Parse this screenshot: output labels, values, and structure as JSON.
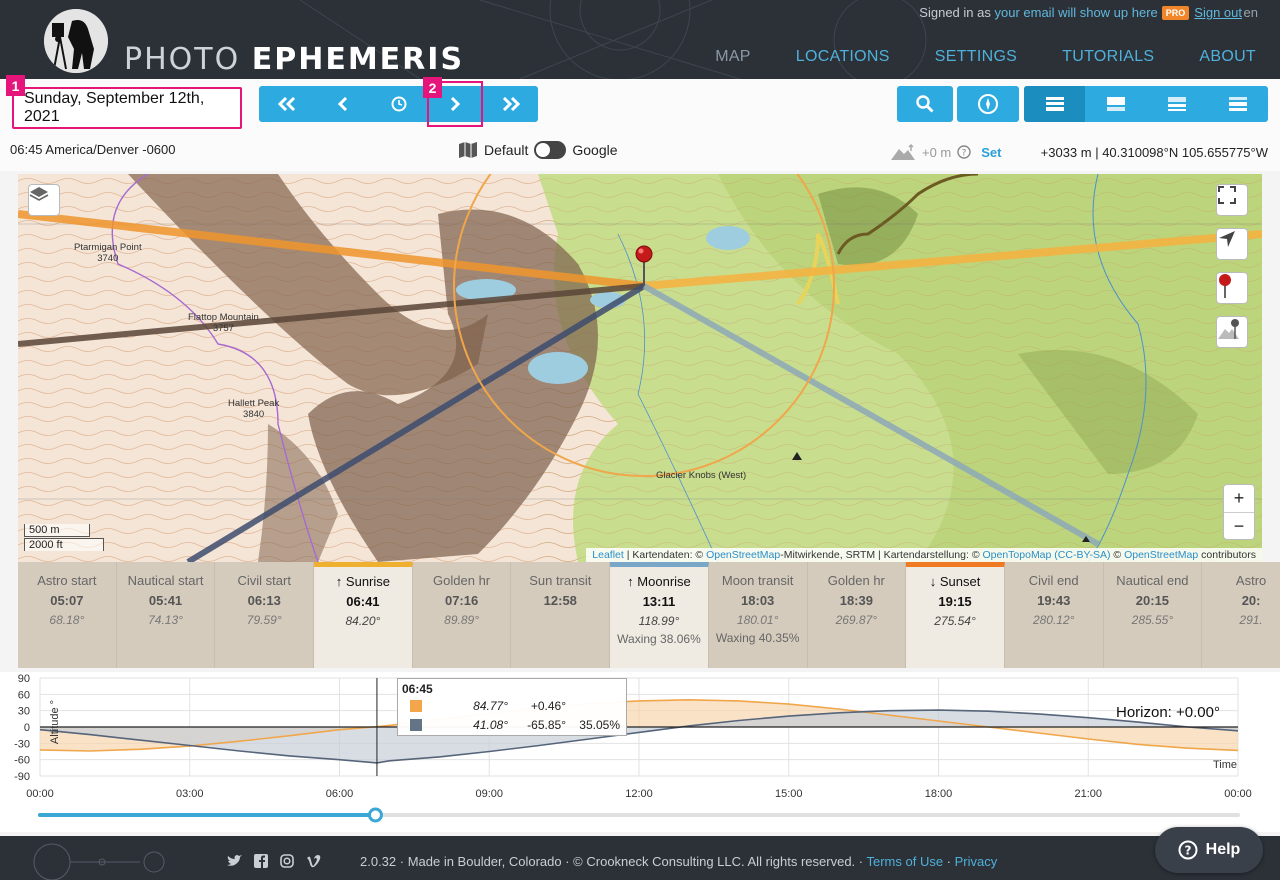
{
  "header": {
    "logo_light": "PHOTO",
    "logo_bold": "EPHEMERIS",
    "signin_prefix": "Signed in as",
    "signin_email": "your email will show up here",
    "pro_badge": "PRO",
    "sign_out": "Sign out",
    "lang": "en",
    "nav": [
      "MAP",
      "LOCATIONS",
      "SETTINGS",
      "TUTORIALS",
      "ABOUT"
    ]
  },
  "toolbar": {
    "date": "Sunday, September 12th, 2021",
    "markers": [
      "1",
      "2"
    ],
    "timezone": "06:45 America/Denver -0600",
    "map_toggle_left": "Default",
    "map_toggle_right": "Google",
    "elevation": "+0 m",
    "elevation_set": "Set",
    "coords": "+3033 m | 40.310098°N 105.655775°W"
  },
  "map": {
    "labels": [
      {
        "name": "Ptarmigan Point",
        "elev": "3740"
      },
      {
        "name": "Flattop Mountain",
        "elev": "3757"
      },
      {
        "name": "Hallett Peak",
        "elev": "3840"
      },
      {
        "name": "Glacier Knobs (West)",
        "elev": ""
      }
    ],
    "scale_m": "500 m",
    "scale_ft": "2000 ft",
    "zoom_in": "+",
    "zoom_out": "−",
    "attribution": {
      "leaflet": "Leaflet",
      "a": " | Kartendaten: © ",
      "osm1": "OpenStreetMap",
      "b": "-Mitwirkende, SRTM | Kartendarstellung: © ",
      "otm": "OpenTopoMap",
      "lic": "(CC-BY-SA)",
      "c": " © ",
      "osm2": "OpenStreetMap",
      "d": " contributors"
    }
  },
  "timeline": [
    {
      "name": "Astro start",
      "time": "05:07",
      "az": "68.18°",
      "extra": ""
    },
    {
      "name": "Nautical start",
      "time": "05:41",
      "az": "74.13°",
      "extra": ""
    },
    {
      "name": "Civil start",
      "time": "06:13",
      "az": "79.59°",
      "extra": ""
    },
    {
      "name": "Sunrise",
      "time": "06:41",
      "az": "84.20°",
      "extra": "",
      "hl": true,
      "color": "#efb02f",
      "arrow": "up"
    },
    {
      "name": "Golden hr",
      "time": "07:16",
      "az": "89.89°",
      "extra": ""
    },
    {
      "name": "Sun transit",
      "time": "12:58",
      "az": "",
      "extra": ""
    },
    {
      "name": "Moonrise",
      "time": "13:11",
      "az": "118.99°",
      "extra": "Waxing 38.06%",
      "hl": true,
      "color": "#7aa7c7",
      "arrow": "up"
    },
    {
      "name": "Moon transit",
      "time": "18:03",
      "az": "180.01°",
      "extra": "Waxing 40.35%"
    },
    {
      "name": "Golden hr",
      "time": "18:39",
      "az": "269.87°",
      "extra": ""
    },
    {
      "name": "Sunset",
      "time": "19:15",
      "az": "275.54°",
      "extra": "",
      "hl": true,
      "color": "#ef7a22",
      "arrow": "down"
    },
    {
      "name": "Civil end",
      "time": "19:43",
      "az": "280.12°",
      "extra": ""
    },
    {
      "name": "Nautical end",
      "time": "20:15",
      "az": "285.55°",
      "extra": ""
    },
    {
      "name": "Astro",
      "time": "20:",
      "az": "291.",
      "extra": ""
    }
  ],
  "chart_data": {
    "type": "area",
    "ylabel": "Altitude °",
    "xlabel": "Time",
    "ylim": [
      -90,
      90
    ],
    "yticks": [
      90,
      60,
      30,
      0,
      -30,
      -60,
      -90
    ],
    "xticks": [
      "00:00",
      "03:00",
      "06:00",
      "09:00",
      "12:00",
      "15:00",
      "18:00",
      "21:00",
      "00:00"
    ],
    "horizon_label": "Horizon: +0.00°",
    "current_time": 6.75,
    "series": [
      {
        "color": "#f0a64a",
        "fill": "#f7d6ae",
        "x": [
          0,
          1,
          2,
          3,
          4,
          5,
          6,
          6.75,
          7,
          8,
          9,
          10,
          11,
          12,
          13,
          14,
          15,
          16,
          17,
          18,
          19,
          20,
          21,
          22,
          23,
          24
        ],
        "y": [
          -42,
          -44,
          -41,
          -35,
          -26,
          -16,
          -5,
          0.5,
          3,
          14,
          25,
          35,
          43,
          48,
          50,
          48,
          42,
          33,
          22,
          11,
          0,
          -11,
          -22,
          -32,
          -39,
          -43
        ]
      },
      {
        "color": "#56647a",
        "fill": "#c7cfd9",
        "x": [
          0,
          1,
          2,
          3,
          4,
          5,
          6,
          6.75,
          7,
          8,
          9,
          10,
          11,
          12,
          13,
          14,
          15,
          16,
          17,
          18,
          19,
          20,
          21,
          22,
          23,
          24
        ],
        "y": [
          -5,
          -14,
          -24,
          -34,
          -44,
          -53,
          -60,
          -65.9,
          -62,
          -55,
          -45,
          -34,
          -22,
          -10,
          2,
          12,
          20,
          26,
          30,
          31,
          29,
          24,
          17,
          9,
          0,
          -7
        ]
      }
    ],
    "tooltip": {
      "time": "06:45",
      "rows": [
        {
          "color": "#f4a64a",
          "azimuth": "84.77°",
          "altitude": "+0.46°",
          "extra": ""
        },
        {
          "color": "#657387",
          "azimuth": "41.08°",
          "altitude": "-65.85°",
          "extra": "35.05%"
        }
      ]
    },
    "slider_fraction": 0.28
  },
  "footer": {
    "text": "2.0.32 · Made in Boulder, Colorado · © Crookneck Consulting LLC. All rights reserved. · ",
    "terms": "Terms of Use",
    "sep": " · ",
    "privacy": "Privacy",
    "help": "Help"
  }
}
